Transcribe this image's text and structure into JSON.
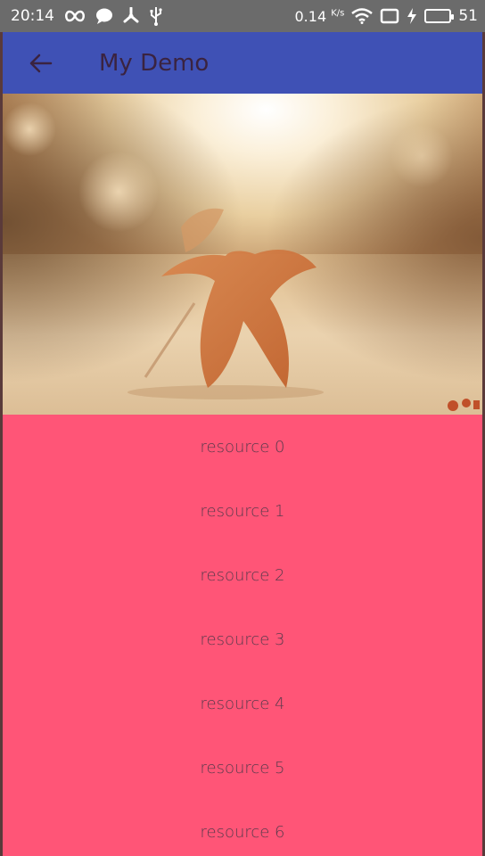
{
  "status_bar": {
    "time": "20:14",
    "net_speed": "0.14",
    "net_unit": "K/s",
    "battery_level": "51",
    "battery_fraction": 0.51,
    "left_icons": [
      "infinity-icon",
      "chat-bubble-icon",
      "fan-icon",
      "usb-icon"
    ],
    "right_icons": [
      "wifi-icon",
      "screen-icon",
      "charging-bolt-icon",
      "battery-icon"
    ]
  },
  "app_bar": {
    "title": "My Demo",
    "back_icon": "arrow-back-icon",
    "color": "#3f51b5"
  },
  "hero_image": {
    "description": "autumn leaf"
  },
  "list": {
    "background": "#ff5577",
    "items": [
      {
        "label": "resource 0"
      },
      {
        "label": "resource 1"
      },
      {
        "label": "resource 2"
      },
      {
        "label": "resource 3"
      },
      {
        "label": "resource 4"
      },
      {
        "label": "resource 5"
      },
      {
        "label": "resource 6"
      }
    ]
  }
}
